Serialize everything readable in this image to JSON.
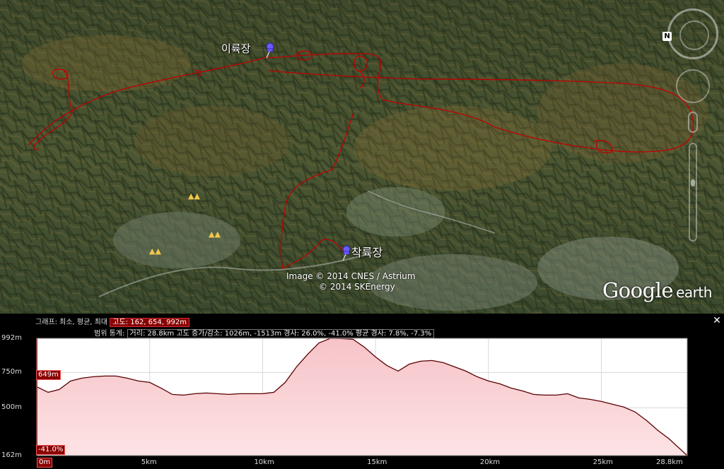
{
  "map": {
    "placemarks": [
      {
        "label": "이륙장"
      },
      {
        "label": "착륙장"
      }
    ],
    "credits": [
      "Image © 2014 CNES / Astrium",
      "© 2014 SKEnergy"
    ],
    "logo": {
      "main": "Google",
      "sub": "earth"
    },
    "nav": {
      "north_label": "N"
    },
    "poi_icon": "attraction-icon",
    "track_color": "#c00000"
  },
  "profile": {
    "graph_line_prefix": "그래프: 최소, 평균, 최대",
    "graph_values": "고도: 162, 654, 992m",
    "range_prefix": "범위 통계:",
    "range_stats": "거리: 28.8km 고도 증가/감소: 1026m, -1513m 경사: 26.0%, -41.0% 평균 경사: 7.8%, -7.3%",
    "close_label": "✕",
    "cursor_elev_label": "649m",
    "cursor_slope_label": "-41.0%",
    "cursor_dist_label": "0m"
  },
  "chart_data": {
    "type": "area",
    "title": "",
    "xlabel": "",
    "ylabel": "",
    "xlim": [
      0,
      28.8
    ],
    "ylim": [
      162,
      992
    ],
    "y_ticks": [
      {
        "value": 992,
        "label": "992m"
      },
      {
        "value": 750,
        "label": "750m"
      },
      {
        "value": 500,
        "label": "500m"
      },
      {
        "value": 162,
        "label": "162m"
      }
    ],
    "x_ticks": [
      {
        "value": 5,
        "label": "5km"
      },
      {
        "value": 10,
        "label": "10km"
      },
      {
        "value": 15,
        "label": "15km"
      },
      {
        "value": 20,
        "label": "20km"
      },
      {
        "value": 25,
        "label": "25km"
      },
      {
        "value": 28.8,
        "label": "28.8km"
      }
    ],
    "grid": true,
    "line_color": "#5a0000",
    "fill_top": "#f7c8cc",
    "fill_bottom": "#fbdfe1",
    "x": [
      0,
      0.5,
      1,
      1.5,
      2,
      2.5,
      3,
      3.5,
      4,
      4.5,
      5,
      5.5,
      6,
      6.5,
      7,
      7.5,
      8,
      8.5,
      9,
      9.5,
      10,
      10.5,
      11,
      11.5,
      12,
      12.5,
      13,
      13.5,
      14,
      14.5,
      15,
      15.5,
      16,
      16.5,
      17,
      17.5,
      18,
      18.5,
      19,
      19.5,
      20,
      20.5,
      21,
      21.5,
      22,
      22.5,
      23,
      23.5,
      24,
      24.5,
      25,
      25.5,
      26,
      26.5,
      27,
      27.5,
      28,
      28.8
    ],
    "y": [
      649,
      610,
      630,
      690,
      710,
      720,
      725,
      725,
      710,
      690,
      680,
      640,
      595,
      590,
      600,
      605,
      600,
      595,
      600,
      600,
      600,
      610,
      680,
      790,
      880,
      960,
      992,
      990,
      985,
      930,
      860,
      800,
      760,
      810,
      830,
      835,
      820,
      790,
      760,
      720,
      690,
      670,
      640,
      620,
      595,
      590,
      590,
      600,
      570,
      560,
      545,
      525,
      505,
      470,
      410,
      340,
      280,
      162
    ]
  }
}
